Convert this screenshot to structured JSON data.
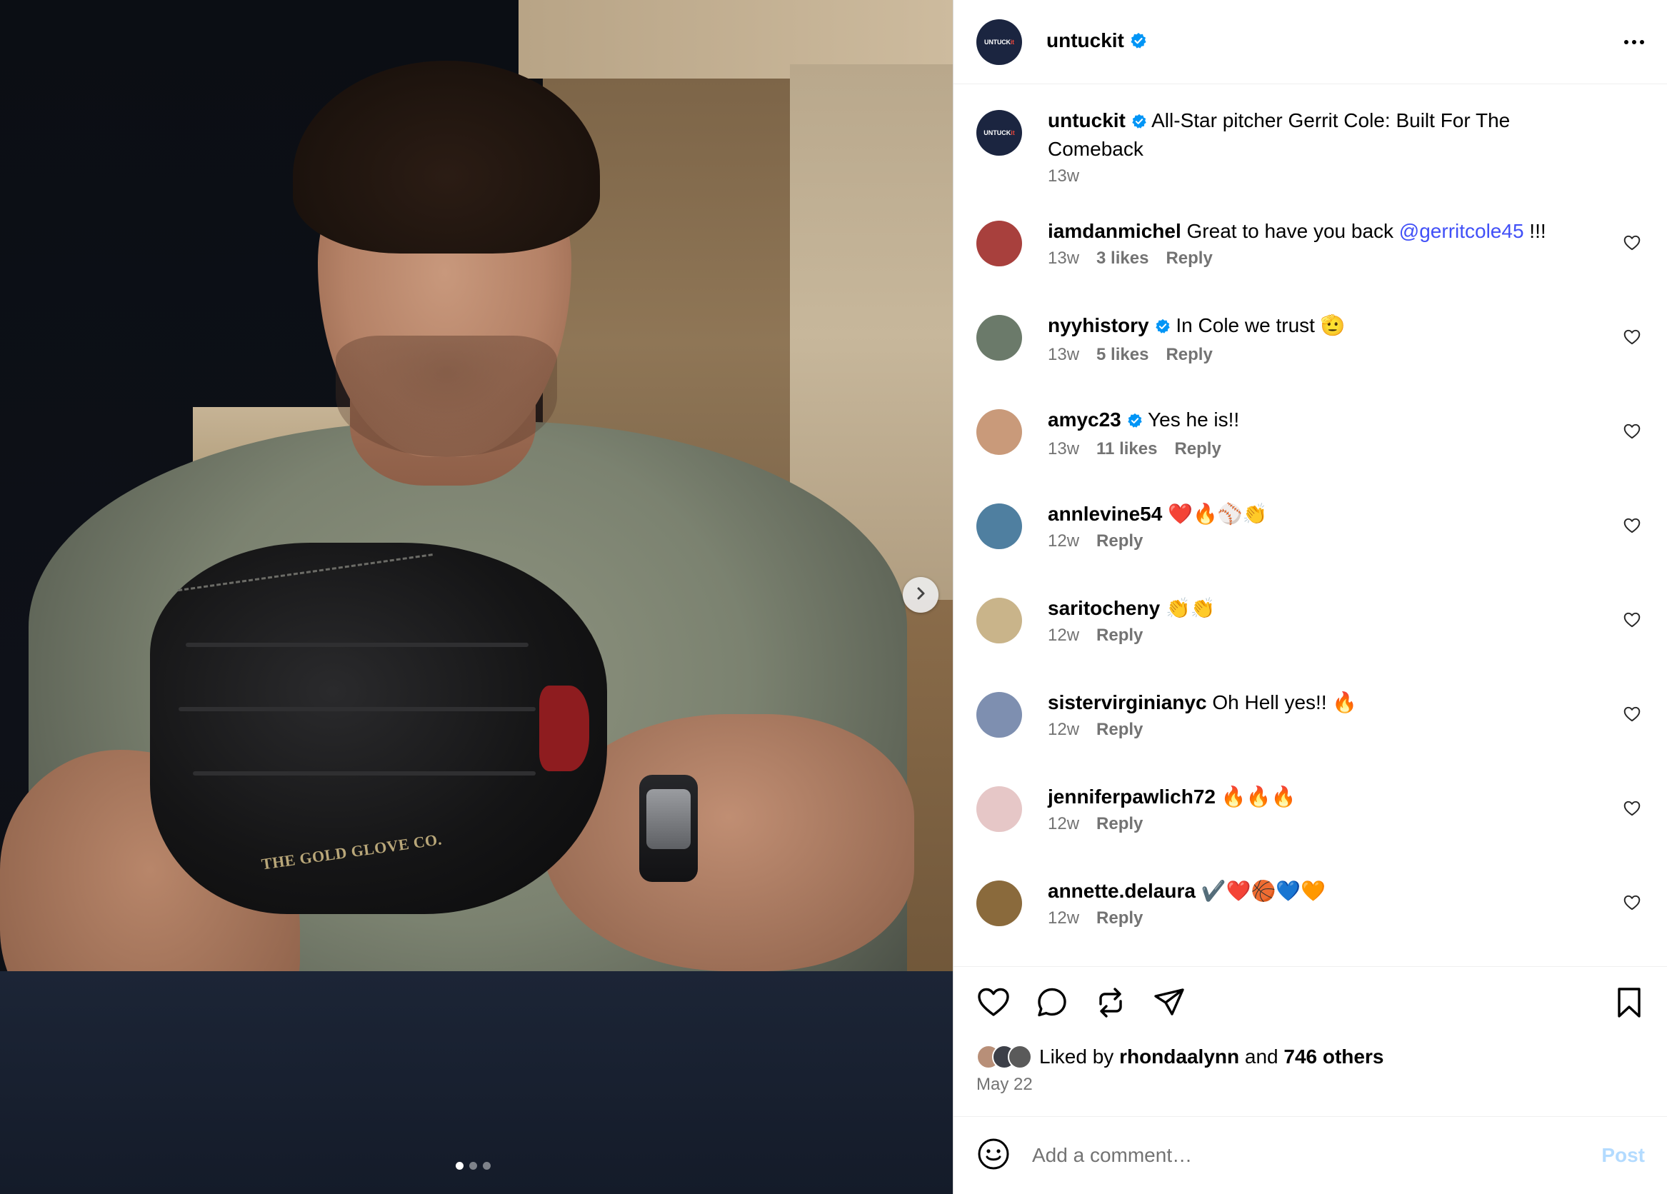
{
  "post": {
    "username": "untuckit",
    "avatar_text_a": "UNTUCK",
    "avatar_text_b": "it",
    "more_icon": "more-horizontal-icon",
    "image": {
      "glove_brand": "THE GOLD GLOVE CO.",
      "carousel_dots": 3,
      "active_dot": 1,
      "next_icon": "chevron-right-icon"
    }
  },
  "caption": {
    "username": "untuckit",
    "text": "All-Star pitcher Gerrit Cole: Built For The Comeback",
    "time": "13w"
  },
  "comments": [
    {
      "username": "iamdanmichel",
      "verified": false,
      "text": "Great to have you back ",
      "mention": "@gerritcole45",
      "suffix": " !!!",
      "time": "13w",
      "likes": "3 likes",
      "reply": "Reply",
      "avatar_color": "#a8403d"
    },
    {
      "username": "nyyhistory",
      "verified": true,
      "text": "In Cole we trust 🫡",
      "time": "13w",
      "likes": "5 likes",
      "reply": "Reply",
      "avatar_color": "#6b7a6a"
    },
    {
      "username": "amyc23",
      "verified": true,
      "text": "Yes he is!!",
      "time": "13w",
      "likes": "11 likes",
      "reply": "Reply",
      "avatar_color": "#c99a7a"
    },
    {
      "username": "annlevine54",
      "verified": false,
      "text": "❤️🔥⚾👏",
      "time": "12w",
      "likes": "",
      "reply": "Reply",
      "avatar_color": "#4f7fa0"
    },
    {
      "username": "saritocheny",
      "verified": false,
      "text": "👏👏",
      "time": "12w",
      "likes": "",
      "reply": "Reply",
      "avatar_color": "#c9b48a"
    },
    {
      "username": "sistervirginianyc",
      "verified": false,
      "text": "Oh Hell yes!! 🔥",
      "time": "12w",
      "likes": "",
      "reply": "Reply",
      "avatar_color": "#7e8fb0"
    },
    {
      "username": "jenniferpawlich72",
      "verified": false,
      "text": "🔥🔥🔥",
      "time": "12w",
      "likes": "",
      "reply": "Reply",
      "avatar_color": "#e6c7c7"
    },
    {
      "username": "annette.delaura",
      "verified": false,
      "text": "✔️❤️🏀💙🧡",
      "time": "12w",
      "likes": "",
      "reply": "Reply",
      "avatar_color": "#8a6a3c"
    }
  ],
  "actions": {
    "icons": [
      "heart-icon",
      "comment-icon",
      "repost-icon",
      "share-icon",
      "bookmark-icon"
    ],
    "liked_prefix": "Liked by ",
    "liked_user": "rhondaalynn",
    "liked_and": " and ",
    "liked_others": "746 others",
    "date": "May 22"
  },
  "composer": {
    "emoji_icon": "emoji-icon",
    "placeholder": "Add a comment…",
    "post_label": "Post"
  },
  "colors": {
    "verified": "#0095f6",
    "mention": "#4150f7",
    "post_disabled": "#b3dbff",
    "brand_avatar": "#1b2540"
  }
}
